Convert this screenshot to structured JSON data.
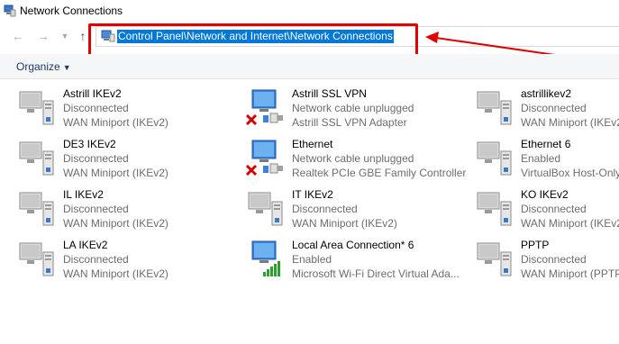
{
  "window": {
    "title": "Network Connections"
  },
  "nav": {
    "back_icon": "back-arrow",
    "forward_icon": "forward-arrow",
    "recent_icon": "chevron-down",
    "up_icon": "up-arrow"
  },
  "address": {
    "path": "Control Panel\\Network and Internet\\Network Connections"
  },
  "command_bar": {
    "organize_label": "Organize"
  },
  "annotation": {
    "color": "#e00000"
  },
  "connections": [
    {
      "name": "Astrill IKEv2",
      "status": "Disconnected",
      "device": "WAN Miniport (IKEv2)",
      "icon": "vpn-icon"
    },
    {
      "name": "Astrill SSL VPN",
      "status": "Network cable unplugged",
      "device": "Astrill SSL VPN Adapter",
      "icon": "ethernet-unplugged-icon"
    },
    {
      "name": "astrillikev2",
      "status": "Disconnected",
      "device": "WAN Miniport (IKEv2)",
      "icon": "vpn-icon"
    },
    {
      "name": "DE3 IKEv2",
      "status": "Disconnected",
      "device": "WAN Miniport (IKEv2)",
      "icon": "vpn-icon"
    },
    {
      "name": "Ethernet",
      "status": "Network cable unplugged",
      "device": "Realtek PCIe GBE Family Controller",
      "icon": "ethernet-unplugged-icon"
    },
    {
      "name": "Ethernet 6",
      "status": "Enabled",
      "device": "VirtualBox Host-Only",
      "icon": "ethernet-enabled-icon"
    },
    {
      "name": "IL IKEv2",
      "status": "Disconnected",
      "device": "WAN Miniport (IKEv2)",
      "icon": "vpn-icon"
    },
    {
      "name": "IT IKEv2",
      "status": "Disconnected",
      "device": "WAN Miniport (IKEv2)",
      "icon": "vpn-icon"
    },
    {
      "name": "KO IKEv2",
      "status": "Disconnected",
      "device": "WAN Miniport (IKEv2)",
      "icon": "vpn-icon"
    },
    {
      "name": "LA IKEv2",
      "status": "Disconnected",
      "device": "WAN Miniport (IKEv2)",
      "icon": "vpn-icon"
    },
    {
      "name": "Local Area Connection* 6",
      "status": "Enabled",
      "device": "Microsoft Wi-Fi Direct Virtual Ada...",
      "icon": "wifi-enabled-icon"
    },
    {
      "name": "PPTP",
      "status": "Disconnected",
      "device": "WAN Miniport (PPTP",
      "icon": "vpn-icon"
    }
  ]
}
